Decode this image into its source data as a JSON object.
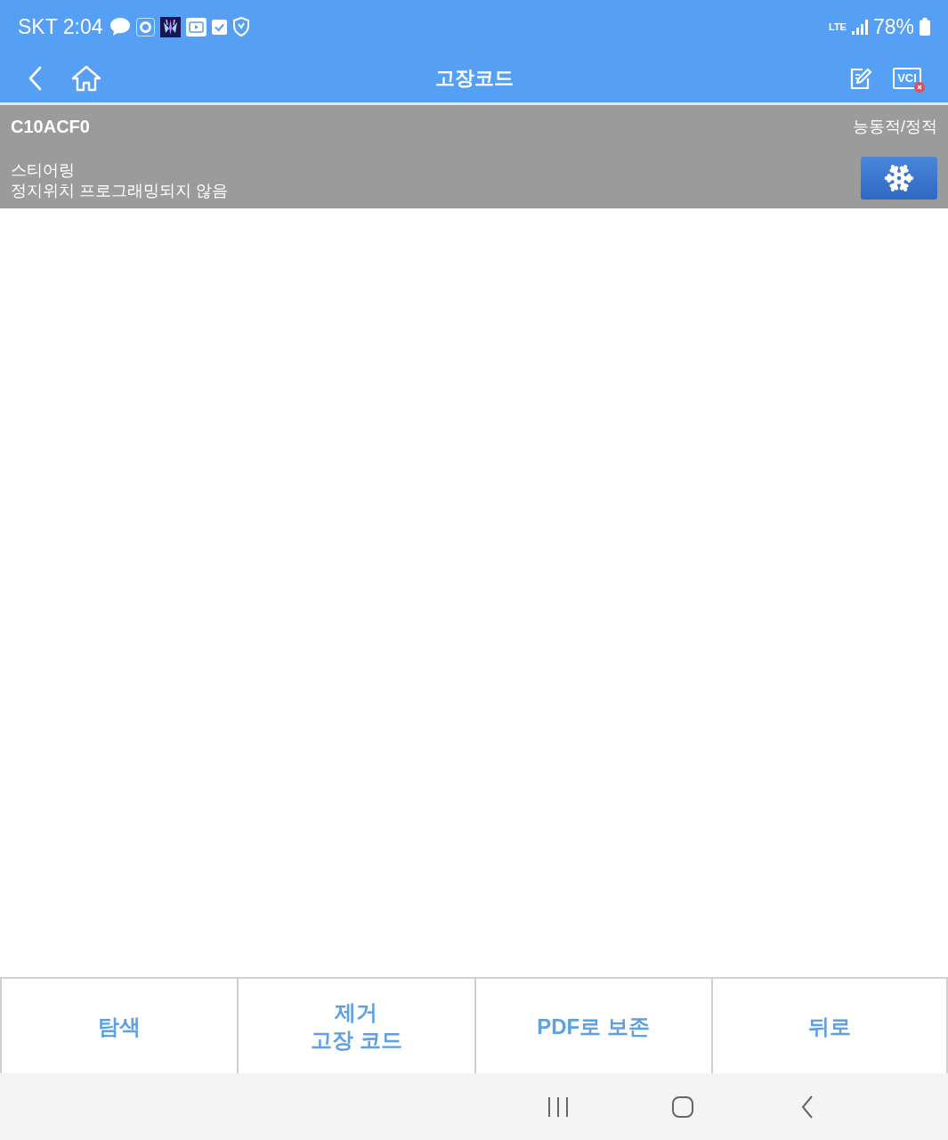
{
  "status_bar": {
    "carrier": "SKT",
    "time": "2:04",
    "network": "LTE",
    "battery": "78%"
  },
  "header": {
    "title": "고장코드",
    "device_label": "VCI",
    "device_connected": false
  },
  "fault": {
    "code": "C10ACF0",
    "status": "능동적/정적",
    "system": "스티어링",
    "description": "정지위치 프로그래밍되지 않음"
  },
  "bottom_buttons": [
    {
      "label": "탐색"
    },
    {
      "label": "제거\n고장 코드"
    },
    {
      "label": "PDF로 보존"
    },
    {
      "label": "뒤로"
    }
  ]
}
